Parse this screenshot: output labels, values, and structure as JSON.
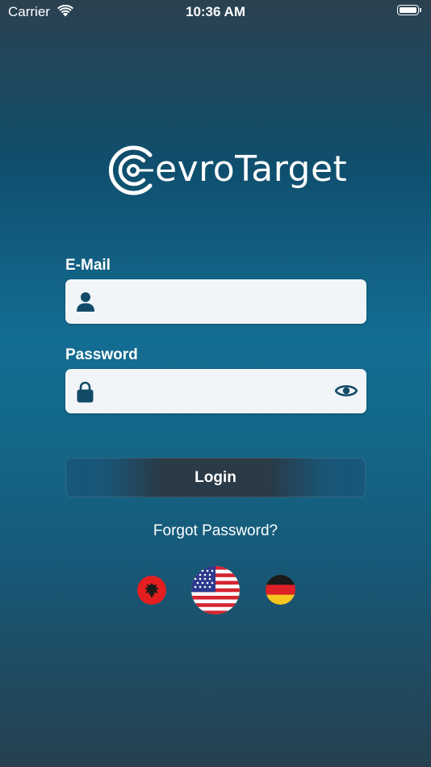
{
  "status_bar": {
    "carrier": "Carrier",
    "time": "10:36 AM",
    "battery_level": 1.0
  },
  "logo": {
    "text": "evroTarget",
    "icon": "target-logo-icon"
  },
  "form": {
    "email": {
      "label": "E-Mail",
      "value": "",
      "placeholder": "",
      "icon": "user-icon"
    },
    "password": {
      "label": "Password",
      "value": "",
      "placeholder": "",
      "icon": "lock-icon",
      "toggle_icon": "eye-icon"
    },
    "login_label": "Login",
    "forgot_label": "Forgot Password?"
  },
  "languages": [
    {
      "code": "sq",
      "icon": "albania-flag-icon",
      "selected": false
    },
    {
      "code": "en",
      "icon": "usa-flag-icon",
      "selected": true
    },
    {
      "code": "de",
      "icon": "germany-flag-icon",
      "selected": false
    }
  ],
  "colors": {
    "background_mid": "#146d93",
    "background_edge": "#2b4150",
    "input_bg": "#f1f5f8",
    "icon_color": "#124a67",
    "button_center": "#2a3a47"
  }
}
